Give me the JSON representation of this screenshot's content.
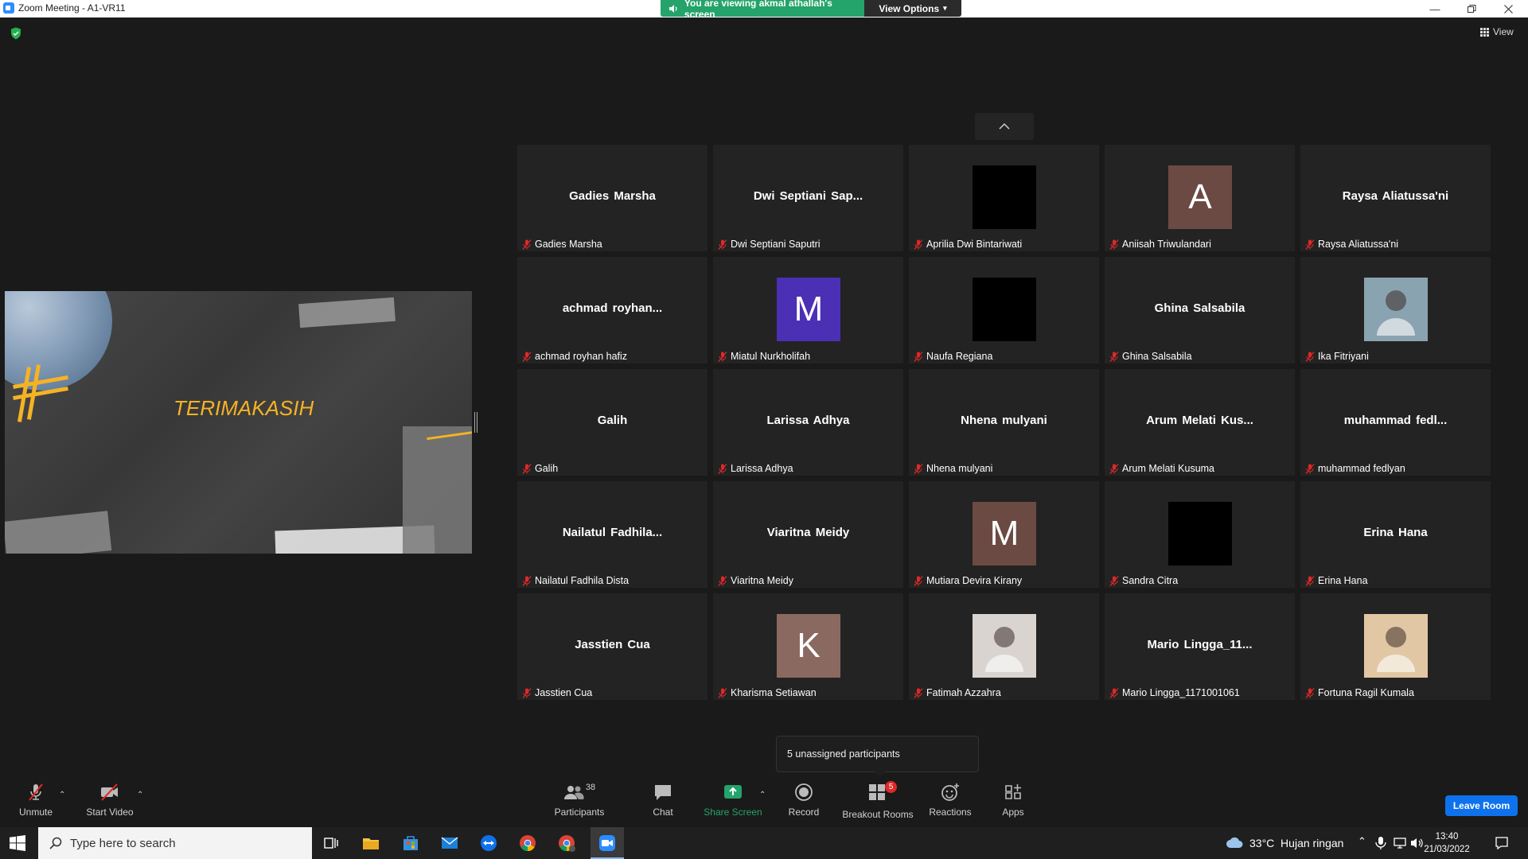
{
  "window": {
    "title": "Zoom Meeting - A1-VR11",
    "banner": "You are viewing akmal athallah's screen",
    "view_options": "View Options",
    "view_label": "View"
  },
  "shared_screen": {
    "slide_text": "TERIMAKASIH"
  },
  "participants": [
    {
      "display": "Gadies Marsha",
      "label": "Gadies Marsha",
      "type": "name"
    },
    {
      "display": "Dwi Septiani Sap...",
      "label": "Dwi Septiani Saputri",
      "type": "name"
    },
    {
      "display": "",
      "label": "Aprilia Dwi Bintariwati",
      "type": "black"
    },
    {
      "display": "A",
      "label": "Aniisah Triwulandari",
      "type": "letter",
      "color": "#6b4a44"
    },
    {
      "display": "Raysa Aliatussa'ni",
      "label": "Raysa Aliatussa'ni",
      "type": "name"
    },
    {
      "display": "achmad royhan...",
      "label": "achmad royhan hafiz",
      "type": "name"
    },
    {
      "display": "M",
      "label": "Miatul Nurkholifah",
      "type": "letter",
      "color": "#4b2fb4"
    },
    {
      "display": "",
      "label": "Naufa Regiana",
      "type": "black"
    },
    {
      "display": "Ghina Salsabila",
      "label": "Ghina Salsabila",
      "type": "name"
    },
    {
      "display": "",
      "label": "Ika Fitriyani",
      "type": "photo",
      "color": "#8aa3b0"
    },
    {
      "display": "Galih",
      "label": "Galih",
      "type": "name"
    },
    {
      "display": "Larissa Adhya",
      "label": "Larissa Adhya",
      "type": "name"
    },
    {
      "display": "Nhena mulyani",
      "label": "Nhena mulyani",
      "type": "name"
    },
    {
      "display": "Arum Melati Kus...",
      "label": "Arum Melati Kusuma",
      "type": "name"
    },
    {
      "display": "muhammad fedl...",
      "label": "muhammad fedlyan",
      "type": "name"
    },
    {
      "display": "Nailatul Fadhila...",
      "label": "Nailatul Fadhila Dista",
      "type": "name"
    },
    {
      "display": "Viaritna Meidy",
      "label": "Viaritna Meidy",
      "type": "name"
    },
    {
      "display": "M",
      "label": "Mutiara Devira Kirany",
      "type": "letter",
      "color": "#6b4a44"
    },
    {
      "display": "",
      "label": "Sandra Citra",
      "type": "black"
    },
    {
      "display": "Erina Hana",
      "label": "Erina Hana",
      "type": "name"
    },
    {
      "display": "Jasstien Cua",
      "label": "Jasstien Cua",
      "type": "name"
    },
    {
      "display": "K",
      "label": "Kharisma Setiawan",
      "type": "letter",
      "color": "#8a6a60"
    },
    {
      "display": "",
      "label": "Fatimah Azzahra",
      "type": "photo",
      "color": "#d9d4d0"
    },
    {
      "display": "Mario Lingga_11...",
      "label": "Mario Lingga_1171001061",
      "type": "name"
    },
    {
      "display": "",
      "label": "Fortuna Ragil Kumala",
      "type": "photo",
      "color": "#e2c7a5"
    }
  ],
  "unassigned": "5 unassigned participants",
  "toolbar": {
    "unmute": "Unmute",
    "start_video": "Start Video",
    "participants": "Participants",
    "participants_count": "38",
    "chat": "Chat",
    "share_screen": "Share Screen",
    "record": "Record",
    "breakout_rooms": "Breakout Rooms",
    "breakout_badge": "5",
    "reactions": "Reactions",
    "apps": "Apps",
    "leave_room": "Leave Room"
  },
  "taskbar": {
    "search_placeholder": "Type here to search",
    "weather": "33°C  Hujan ringan",
    "time": "13:40",
    "date": "21/03/2022"
  },
  "colors": {
    "share_green": "#24a36a",
    "leave_blue": "#0e72ed",
    "slide_accent": "#f5b324",
    "mute_red": "#e02828",
    "badge_red": "#e02828"
  }
}
